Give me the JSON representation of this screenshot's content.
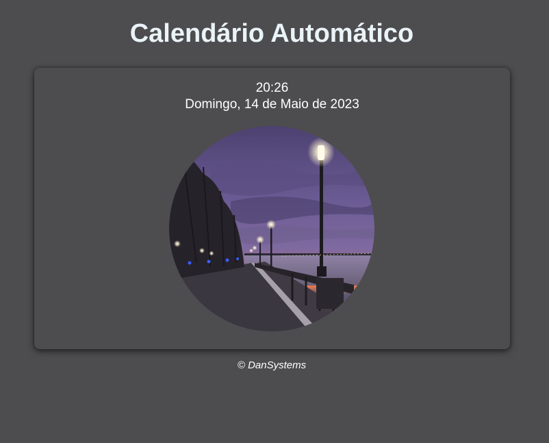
{
  "header": {
    "title": "Calendário Automático"
  },
  "clock": {
    "time": "20:26",
    "date": "Domingo, 14 de Maio de 2023"
  },
  "photo": {
    "icon": "night-waterfront-promenade-image"
  },
  "footer": {
    "copyright": "© DanSystems"
  },
  "colors": {
    "background": "#4d4d4f",
    "title": "#eaf3f8",
    "text": "#ffffff"
  }
}
